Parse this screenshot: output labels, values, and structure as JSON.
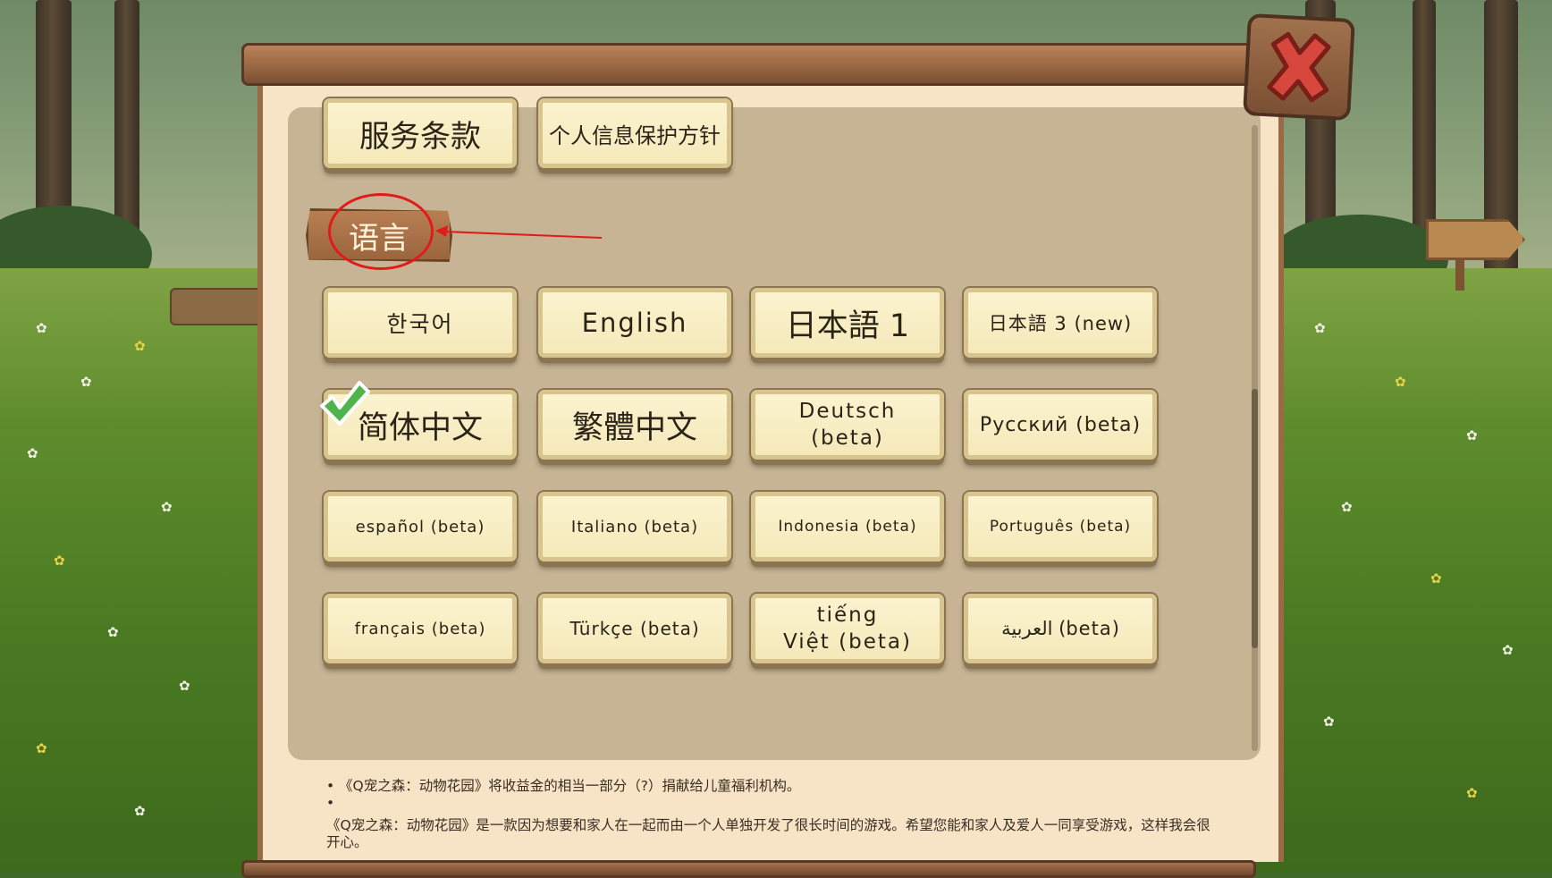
{
  "top_buttons": {
    "terms_label": "服务条款",
    "privacy_label": "个人信息保护方针"
  },
  "language_section": {
    "header": "语言",
    "selected_language": "简体中文",
    "languages": [
      "한국어",
      "English",
      "日本語 1",
      "日本語 3 (new)",
      "简体中文",
      "繁體中文",
      "Deutsch (beta)",
      "Русский (beta)",
      "español (beta)",
      "Italiano (beta)",
      "Indonesia (beta)",
      "Português (beta)",
      "français (beta)",
      "Türkçe (beta)",
      "tiếng Việt (beta)",
      "العربية (beta)"
    ],
    "two_line_parts": {
      "deutsch": [
        "Deutsch",
        "(beta)"
      ],
      "vietnamese": [
        "tiếng",
        "Việt (beta)"
      ]
    }
  },
  "footer_notes": {
    "bullet_1": "《Q宠之森：动物花园》将收益金的相当一部分（?）捐献给儿童福利机构。",
    "bullet_2": "",
    "paragraph": "《Q宠之森：动物花园》是一款因为想要和家人在一起而由一个人单独开发了很长时间的游戏。希望您能和家人及爱人一同享受游戏，这样我会很开心。"
  },
  "icons": {
    "close": "close-x-icon",
    "selected": "checkmark-icon"
  },
  "colors": {
    "annotation_red": "#e11b1b",
    "button_face": "#f8efc8",
    "wood": "#9c6a45"
  }
}
